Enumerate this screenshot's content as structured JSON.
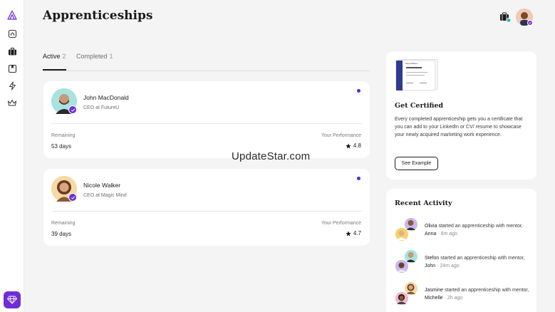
{
  "page": {
    "title": "Apprenticeships"
  },
  "tabs": [
    {
      "label": "Active",
      "count": "2"
    },
    {
      "label": "Completed",
      "count": "1"
    }
  ],
  "mentors": [
    {
      "name": "John MacDonald",
      "role": "CEO at FutureU",
      "remaining_label": "Remaining",
      "remaining": "53 days",
      "performance_label": "Your Performance",
      "performance": "4.8"
    },
    {
      "name": "Nicole Walker",
      "role": "CEO at Magic Mind",
      "remaining_label": "Remaining",
      "remaining": "39 days",
      "performance_label": "Your Performance",
      "performance": "4.7"
    }
  ],
  "certificate": {
    "title": "Get Certified",
    "description": "Every completed apprenticeship gets you a certificate that you can add to your LinkedIn or CV/ resume to showcase your newly acquired marketing work experience.",
    "button": "See Example",
    "preview_name": "Sanya Williams"
  },
  "activity": {
    "title": "Recent Activity",
    "items": [
      {
        "user": "Olivia",
        "text": " started an apprenticeship with mentor, ",
        "mentor": "Anna",
        "time": " · 6m ago"
      },
      {
        "user": "Stefon",
        "text": " started an apprenticeship with mentor, ",
        "mentor": "John",
        "time": " · 24m ago"
      },
      {
        "user": "Jasmine",
        "text": " started an apprenticeship with mentor, ",
        "mentor": "Michelle",
        "time": " · 2h ago"
      }
    ]
  },
  "watermark": "UpdateStar.com",
  "colors": {
    "accent": "#6d2ed6",
    "dot": "#4a2fd8",
    "background": "#f4f4f4",
    "card": "#ffffff",
    "teal_badge": "#2bbfae"
  },
  "icons": {
    "sidebar": [
      "logo-icon",
      "home-icon",
      "briefcase-icon",
      "bookmark-icon",
      "lightning-icon",
      "crown-icon",
      "gem-icon"
    ],
    "top": [
      "briefcase-icon",
      "avatar"
    ]
  }
}
